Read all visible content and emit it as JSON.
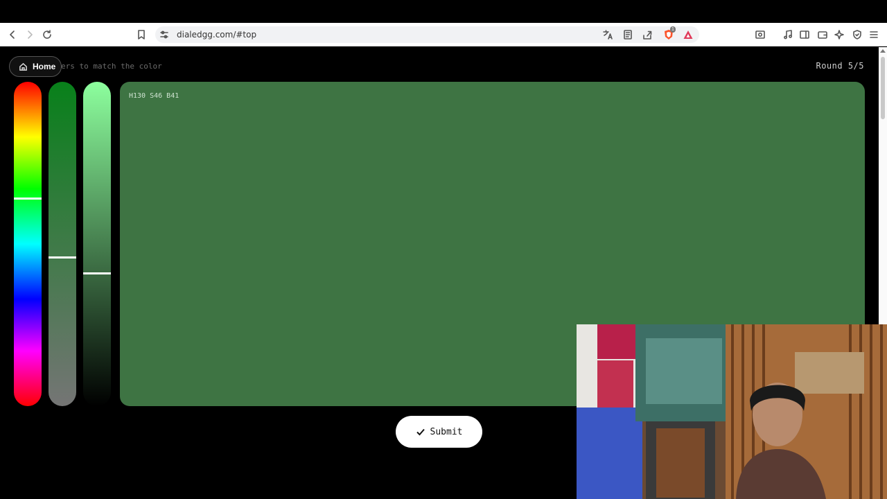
{
  "browser": {
    "url": "dialedgg.com/#top",
    "shield_badge": "1"
  },
  "page": {
    "home_label": "Home",
    "instruction": "ers to match the color",
    "round": "Round 5/5",
    "swatch_label": "H130 S46 B41",
    "swatch_color": "#3e7443",
    "submit_label": "Submit"
  },
  "sliders": {
    "hue_level": 0.36,
    "saturation_level": 0.54,
    "brightness_level": 0.59
  }
}
